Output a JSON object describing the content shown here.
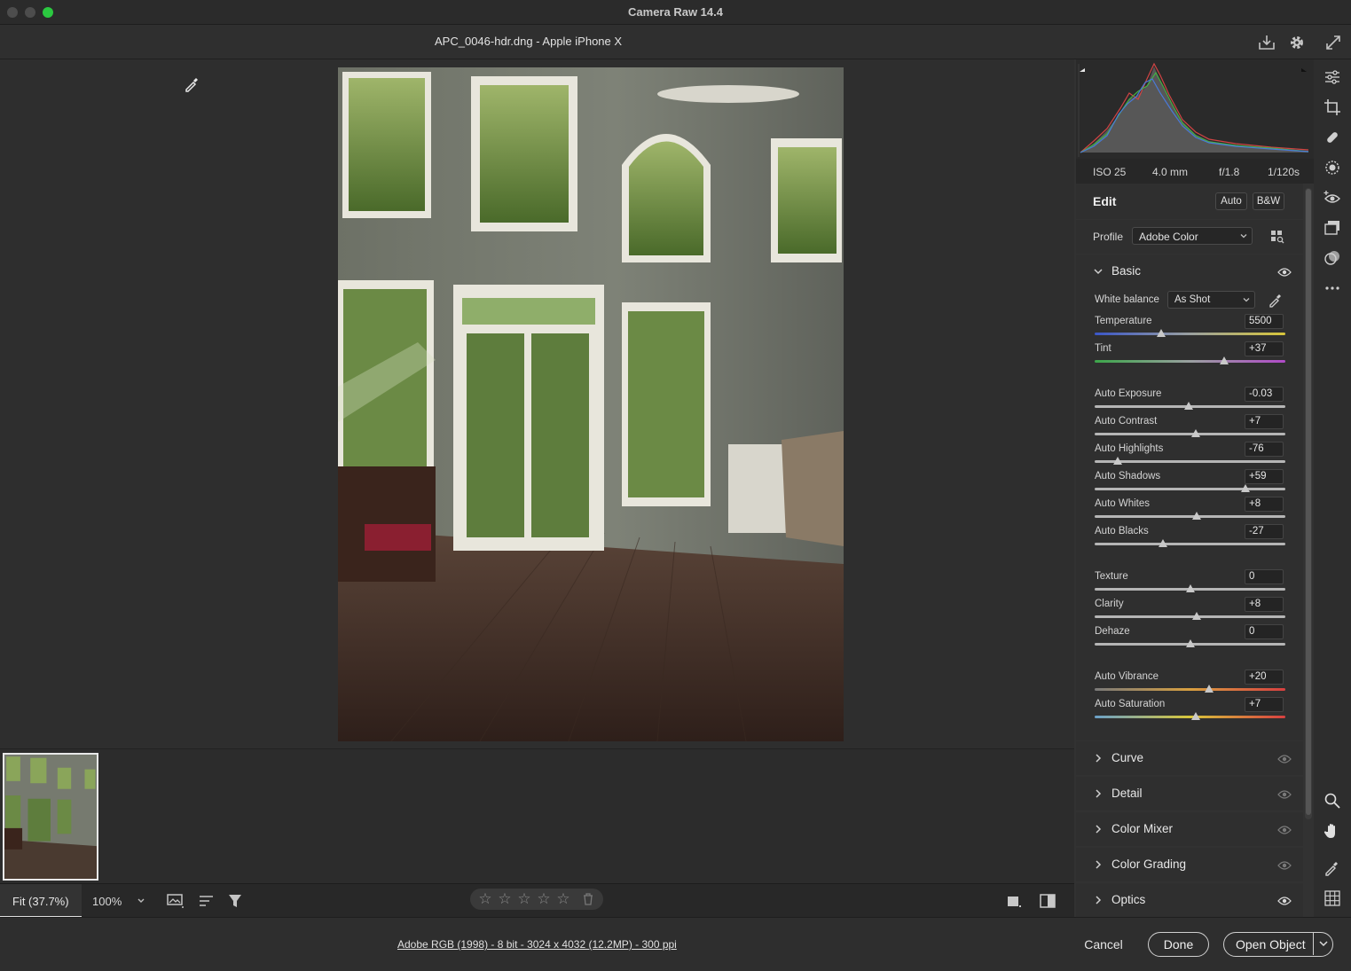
{
  "window": {
    "title": "Camera Raw 14.4"
  },
  "document": {
    "title": "APC_0046-hdr.dng  -  Apple iPhone X"
  },
  "exif": {
    "iso": "ISO 25",
    "focal": "4.0 mm",
    "aperture": "f/1.8",
    "shutter": "1/120s"
  },
  "edit": {
    "title": "Edit",
    "auto_label": "Auto",
    "bw_label": "B&W",
    "profile_label": "Profile",
    "profile_value": "Adobe Color"
  },
  "basic": {
    "title": "Basic",
    "white_balance_label": "White balance",
    "white_balance_value": "As Shot",
    "sliders": [
      {
        "label": "Temperature",
        "value": "5500",
        "position": 0.35
      },
      {
        "label": "Tint",
        "value": "+37",
        "position": 0.68
      },
      {
        "label": "Auto Exposure",
        "value": "-0.03",
        "position": 0.495
      },
      {
        "label": "Auto Contrast",
        "value": "+7",
        "position": 0.53
      },
      {
        "label": "Auto Highlights",
        "value": "-76",
        "position": 0.12
      },
      {
        "label": "Auto Shadows",
        "value": "+59",
        "position": 0.79
      },
      {
        "label": "Auto Whites",
        "value": "+8",
        "position": 0.535
      },
      {
        "label": "Auto Blacks",
        "value": "-27",
        "position": 0.36
      },
      {
        "label": "Texture",
        "value": "0",
        "position": 0.5
      },
      {
        "label": "Clarity",
        "value": "+8",
        "position": 0.535
      },
      {
        "label": "Dehaze",
        "value": "0",
        "position": 0.5
      },
      {
        "label": "Auto Vibrance",
        "value": "+20",
        "position": 0.6
      },
      {
        "label": "Auto Saturation",
        "value": "+7",
        "position": 0.53
      }
    ]
  },
  "sections": [
    {
      "label": "Curve"
    },
    {
      "label": "Detail"
    },
    {
      "label": "Color Mixer"
    },
    {
      "label": "Color Grading"
    },
    {
      "label": "Optics"
    }
  ],
  "bottombar": {
    "fit_label": "Fit (37.7%)",
    "zoom_value": "100%"
  },
  "footer": {
    "workflow_link": "Adobe RGB (1998) - 8 bit - 3024 x 4032 (12.2MP) - 300 ppi",
    "cancel_label": "Cancel",
    "done_label": "Done",
    "open_label": "Open Object"
  },
  "colors": {
    "accent_traffic_max": "#2bc840",
    "panel_bg": "#323232",
    "canvas_bg": "#2e2e2e"
  },
  "icons": [
    "download-icon",
    "gear-icon",
    "fullscreen-icon",
    "eyedropper-cursor-icon",
    "edit-sliders-icon",
    "crop-icon",
    "healing-icon",
    "mask-icon",
    "redeye-icon",
    "snapshots-icon",
    "presets-icon",
    "more-icon",
    "zoom-icon",
    "hand-icon",
    "sampler-icon",
    "grid-icon"
  ]
}
